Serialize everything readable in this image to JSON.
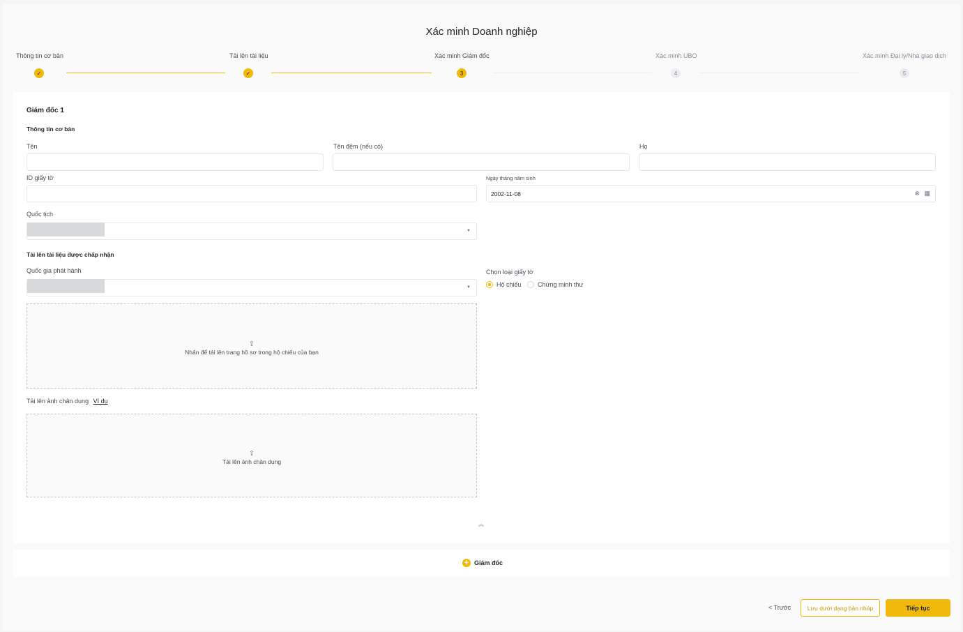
{
  "page": {
    "title": "Xác minh Doanh nghiệp"
  },
  "stepper": {
    "steps": [
      {
        "label": "Thông tin cơ bản",
        "status": "done",
        "marker": "✓"
      },
      {
        "label": "Tải lên tài liệu",
        "status": "done",
        "marker": "✓"
      },
      {
        "label": "Xác minh Giám đốc",
        "status": "current",
        "marker": "3"
      },
      {
        "label": "Xác minh UBO",
        "status": "todo",
        "marker": "4"
      },
      {
        "label": "Xác minh Đại lý/Nhà giao dịch",
        "status": "todo",
        "marker": "5"
      }
    ]
  },
  "director": {
    "title": "Giám đốc 1",
    "basic_info_heading": "Thông tin cơ bản",
    "first_name": {
      "label": "Tên",
      "value": ""
    },
    "middle_name": {
      "label": "Tên đệm (nếu có)",
      "value": ""
    },
    "last_name": {
      "label": "Họ",
      "value": ""
    },
    "id_number": {
      "label": "ID giấy tờ",
      "value": ""
    },
    "dob": {
      "label": "Ngày tháng năm sinh",
      "value": "2002-11-08"
    },
    "nationality": {
      "label": "Quốc tịch",
      "value": ""
    },
    "documents_heading": "Tải lên tài liệu được chấp nhận",
    "issuing_country": {
      "label": "Quốc gia phát hành",
      "value": ""
    },
    "doc_type": {
      "label": "Chọn loại giấy tờ",
      "options": [
        {
          "label": "Hộ chiếu",
          "selected": true
        },
        {
          "label": "Chứng minh thư",
          "selected": false
        }
      ]
    },
    "passport_upload": {
      "text": "Nhấn để tải lên trang hồ sơ trong hộ chiếu của bạn"
    },
    "portrait": {
      "label": "Tải lên ảnh chân dung",
      "example_link": "Ví dụ",
      "upload_text": "Tải lên ảnh chân dung"
    }
  },
  "add_director": {
    "label": "Giám đốc"
  },
  "footer": {
    "prev_label": "< Trước",
    "draft_label": "Lưu dưới dạng bản nháp",
    "next_label": "Tiếp tục"
  },
  "colors": {
    "accent": "#f0b90b",
    "text": "#1e2329",
    "muted": "#848e9c"
  }
}
